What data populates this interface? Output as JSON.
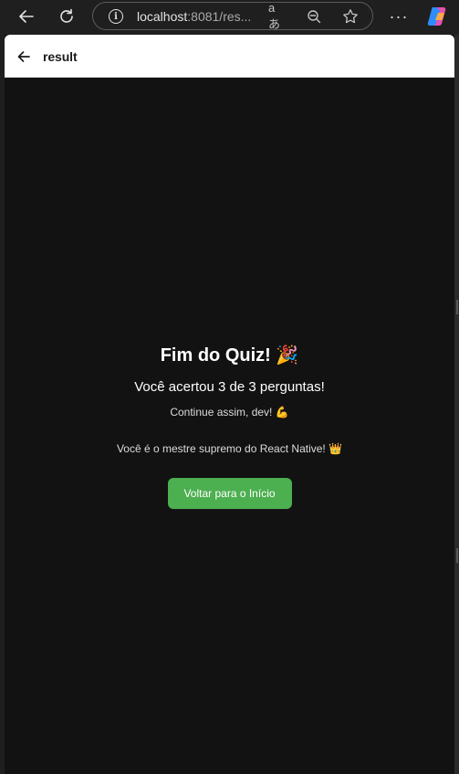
{
  "browser": {
    "url_host": "localhost",
    "url_rest": ":8081/res...",
    "read_aloud_label": "aあ",
    "more_label": "···"
  },
  "header": {
    "title": "result"
  },
  "result": {
    "title": "Fim do Quiz! 🎉",
    "score": "Você acertou 3 de 3 perguntas!",
    "encouragement": "Continue assim, dev! 💪",
    "praise": "Você é o mestre supremo do React Native! 👑",
    "button_label": "Voltar para o Início"
  },
  "colors": {
    "background": "#121212",
    "header_bg": "#ffffff",
    "button_bg": "#4caf50",
    "text": "#ffffff"
  }
}
